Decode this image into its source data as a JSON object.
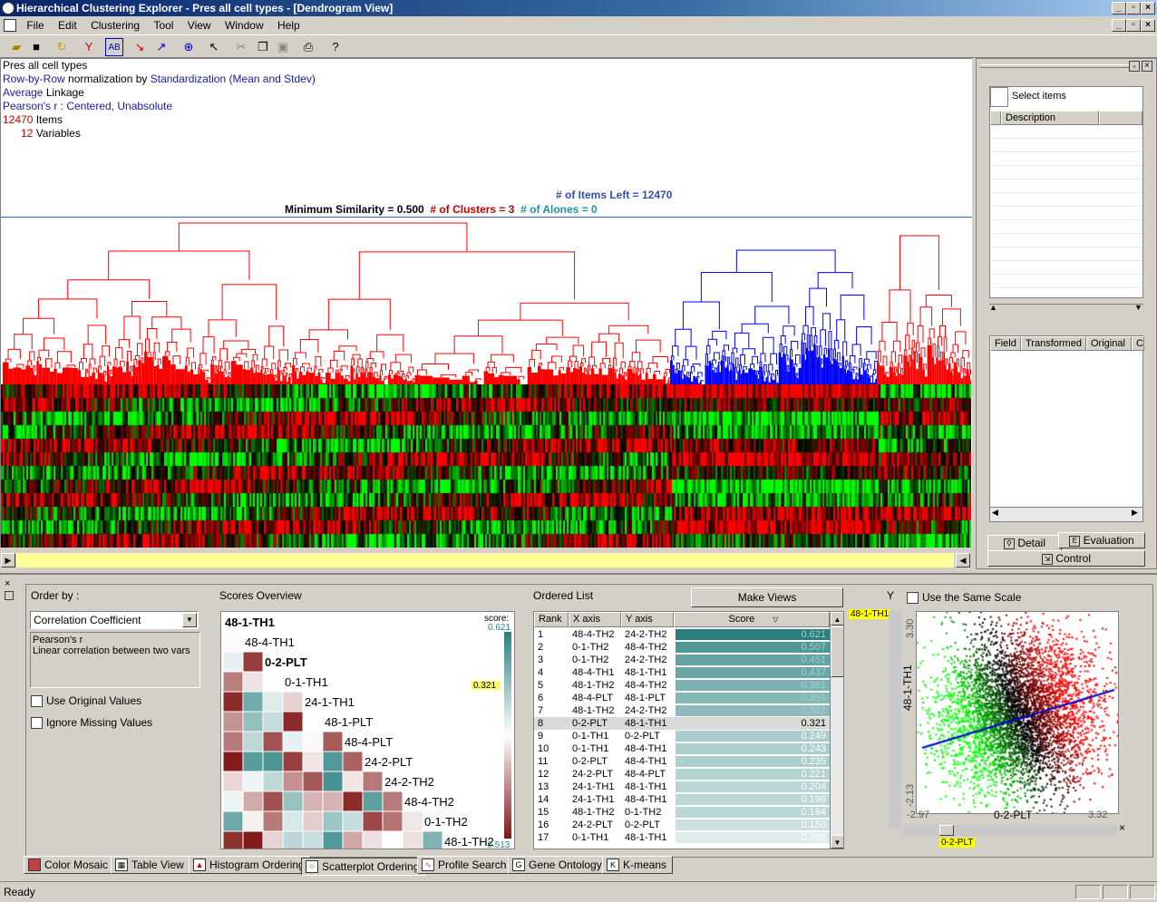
{
  "window": {
    "title": "Hierarchical Clustering Explorer - Pres all cell types - [Dendrogram View]"
  },
  "menu": [
    "File",
    "Edit",
    "Clustering",
    "Tool",
    "View",
    "Window",
    "Help"
  ],
  "info": {
    "line1": "Pres all cell types",
    "norm_prefix": "Row-by-Row",
    "norm_mid": " normalization by ",
    "norm_method": "Standardization (Mean and Stdev)",
    "linkage_a": "Average",
    "linkage_b": " Linkage",
    "pearson": "Pearson's r : Centered, Unabsolute",
    "items_n": "12470",
    "items_l": " Items",
    "vars_n": "12",
    "vars_l": " Variables"
  },
  "dendrogram": {
    "items_left": "# of Items Left = 12470",
    "min_sim": "Minimum Similarity = 0.500",
    "clusters": "# of Clusters = 3",
    "alones": "# of Alones = 0"
  },
  "right_panel": {
    "select_items": "Select items",
    "description": "Description",
    "cols": [
      "Field",
      "Transformed",
      "Original",
      "C"
    ],
    "tabs": {
      "detail": "Detail",
      "evaluation": "Evaluation",
      "control": "Control"
    }
  },
  "bottom": {
    "order_by": "Order by :",
    "method": "Correlation Coefficient",
    "method_desc1": "Pearson's r",
    "method_desc2": "Linear correlation between two vars",
    "use_original": "Use Original Values",
    "ignore_missing": "Ignore Missing Values",
    "scores_overview": "Scores Overview",
    "score_label": "score:",
    "score_max": "0.621",
    "score_mid": "0.321",
    "score_min": "-0.513",
    "matrix_labels": [
      "48-1-TH1",
      "48-4-TH1",
      "0-2-PLT",
      "0-1-TH1",
      "24-1-TH1",
      "48-1-PLT",
      "48-4-PLT",
      "24-2-PLT",
      "24-2-TH2",
      "48-4-TH2",
      "0-1-TH2",
      "48-1-TH2"
    ],
    "ordered_list": "Ordered List",
    "make_views": "Make Views",
    "list_cols": [
      "Rank",
      "X axis",
      "Y axis",
      "Score"
    ],
    "rows": [
      [
        "1",
        "48-4-TH2",
        "24-2-TH2",
        "0.621"
      ],
      [
        "2",
        "0-1-TH2",
        "48-4-TH2",
        "0.507"
      ],
      [
        "3",
        "0-1-TH2",
        "24-2-TH2",
        "0.451"
      ],
      [
        "4",
        "48-4-TH1",
        "48-1-TH1",
        "0.437"
      ],
      [
        "5",
        "48-1-TH2",
        "48-4-TH2",
        "0.381"
      ],
      [
        "6",
        "48-4-PLT",
        "48-1-PLT",
        "0.354"
      ],
      [
        "7",
        "48-1-TH2",
        "24-2-TH2",
        "0.331"
      ],
      [
        "8",
        "0-2-PLT",
        "48-1-TH1",
        "0.321"
      ],
      [
        "9",
        "0-1-TH1",
        "0-2-PLT",
        "0.249"
      ],
      [
        "10",
        "0-1-TH1",
        "48-4-TH1",
        "0.243"
      ],
      [
        "11",
        "0-2-PLT",
        "48-4-TH1",
        "0.235"
      ],
      [
        "12",
        "24-2-PLT",
        "48-4-PLT",
        "0.221"
      ],
      [
        "13",
        "24-1-TH1",
        "48-1-TH1",
        "0.204"
      ],
      [
        "14",
        "24-1-TH1",
        "48-4-TH1",
        "0.196"
      ],
      [
        "15",
        "48-1-TH2",
        "0-1-TH2",
        "0.194"
      ],
      [
        "16",
        "24-2-PLT",
        "0-2-PLT",
        "0.150"
      ],
      [
        "17",
        "0-1-TH1",
        "48-1-TH1",
        "0.098"
      ]
    ],
    "y_label": "Y",
    "same_scale": "Use the Same Scale",
    "y_var": "48-1-TH1",
    "x_var": "0-2-PLT",
    "y_top": "3.30",
    "y_bot": "-2.13",
    "x_left": "-2.97",
    "x_right": "3.32"
  },
  "tabs": [
    "Color Mosaic",
    "Table View",
    "Histogram Ordering",
    "Scatterplot Ordering",
    "Profile Search",
    "Gene Ontology",
    "K-means"
  ],
  "status": "Ready",
  "colors": {
    "cluster1": "#ff0000",
    "cluster2": "#0000ff",
    "teal": "#2a8080"
  }
}
